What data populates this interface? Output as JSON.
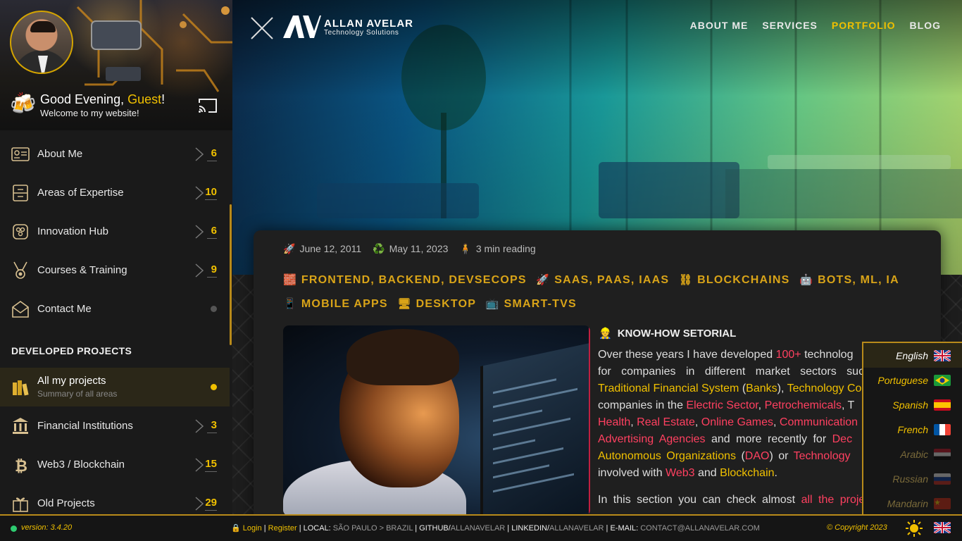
{
  "sidebar": {
    "greeting_prefix": "Good Evening,",
    "greeting_name": "Guest",
    "greeting_suffix": "!",
    "welcome": "Welcome to my website!",
    "items": [
      {
        "label": "About Me",
        "count": "6",
        "icon": "id-card-icon"
      },
      {
        "label": "Areas of Expertise",
        "count": "10",
        "icon": "tray-icon"
      },
      {
        "label": "Innovation Hub",
        "count": "6",
        "icon": "hub-icon"
      },
      {
        "label": "Courses & Training",
        "count": "9",
        "icon": "medal-icon"
      },
      {
        "label": "Contact Me",
        "count": "",
        "icon": "envelope-icon"
      }
    ],
    "section_title": "DEVELOPED PROJECTS",
    "projects": [
      {
        "label": "All my projects",
        "sub": "Summary of all areas",
        "count": "",
        "icon": "books-icon"
      },
      {
        "label": "Financial Institutions",
        "count": "3",
        "icon": "bank-icon"
      },
      {
        "label": "Web3 / Blockchain",
        "count": "15",
        "icon": "bitcoin-icon"
      },
      {
        "label": "Old Projects",
        "count": "29",
        "icon": "gift-icon"
      }
    ]
  },
  "header": {
    "logo_name": "ALLAN AVELAR",
    "logo_sub": "Technology Solutions",
    "nav": [
      {
        "label": "ABOUT ME"
      },
      {
        "label": "SERVICES"
      },
      {
        "label": "PORTFOLIO"
      },
      {
        "label": "BLOG"
      }
    ]
  },
  "article": {
    "created": "June 12, 2011",
    "updated": "May 11, 2023",
    "reading": "3 min reading",
    "tags": [
      {
        "icon": "🧱",
        "text": "FRONTEND, BACKEND, DEVSECOPS"
      },
      {
        "icon": "🚀",
        "text": "SAAS, PAAS, IAAS"
      },
      {
        "icon": "⛓",
        "text": "BLOCKCHAINS"
      },
      {
        "icon": "🤖",
        "text": "BOTS, ML, IA"
      },
      {
        "icon": "📱",
        "text": "MOBILE APPS"
      },
      {
        "icon": "🖥",
        "text": "DESKTOP"
      },
      {
        "icon": "📺",
        "text": "SMART-TVS"
      }
    ],
    "section_title": "KNOW-HOW SETORIAL",
    "text": {
      "l1a": "Over these years I have developed ",
      "l1b": "100+",
      "l1c": " technolog",
      "l2": "for companies in different market sectors suc",
      "l3a": "Traditional Financial System",
      "l3b": " (",
      "l3c": "Banks",
      "l3d": "), ",
      "l3e": "Technology Con",
      "l4a": "companies in the ",
      "l4b": "Electric Sector",
      "l4c": ", ",
      "l4d": "Petrochemicals",
      "l4e": ", T",
      "l5a": "Health",
      "l5b": ", ",
      "l5c": "Real Estate",
      "l5d": ", ",
      "l5e": "Online Games",
      "l5f": ", ",
      "l5g": "Communication",
      "l6a": "Advertising Agencies",
      "l6b": " and more recently for ",
      "l6c": "Dec",
      "l7a": "Autonomous Organizations",
      "l7b": " (",
      "l7c": "DAO",
      "l7d": ") or ",
      "l7e": "Technology",
      "l8a": "involved with ",
      "l8b": "Web3",
      "l8c": " and ",
      "l8d": "Blockchain",
      "l8e": ".",
      "p2a": "In this section you can check almost ",
      "p2b": "all the proje"
    }
  },
  "languages": [
    {
      "label": "English",
      "state": "selected"
    },
    {
      "label": "Portuguese",
      "state": "enabled"
    },
    {
      "label": "Spanish",
      "state": "enabled"
    },
    {
      "label": "French",
      "state": "enabled"
    },
    {
      "label": "Arabic",
      "state": "disabled"
    },
    {
      "label": "Russian",
      "state": "disabled"
    },
    {
      "label": "Mandarin",
      "state": "disabled"
    }
  ],
  "footer": {
    "version": "version: 3.4.20",
    "login": "Login",
    "sep1": " | ",
    "register": "Register",
    "local_label": " | LOCAL: ",
    "local_value": "SÃO PAULO > BRAZIL",
    "github_label": " | GITHUB/",
    "github_value": "ALLANAVELAR",
    "linkedin_label": " | LINKEDIN/",
    "linkedin_value": "ALLANAVELAR",
    "email_label": " | E-MAIL: ",
    "email_value": "CONTACT@ALLANAVELAR.COM",
    "copyright": "© Copyright 2023"
  },
  "colors": {
    "accent": "#f0c000",
    "highlight_red": "#ff4060",
    "status_green": "#2ecc71"
  }
}
